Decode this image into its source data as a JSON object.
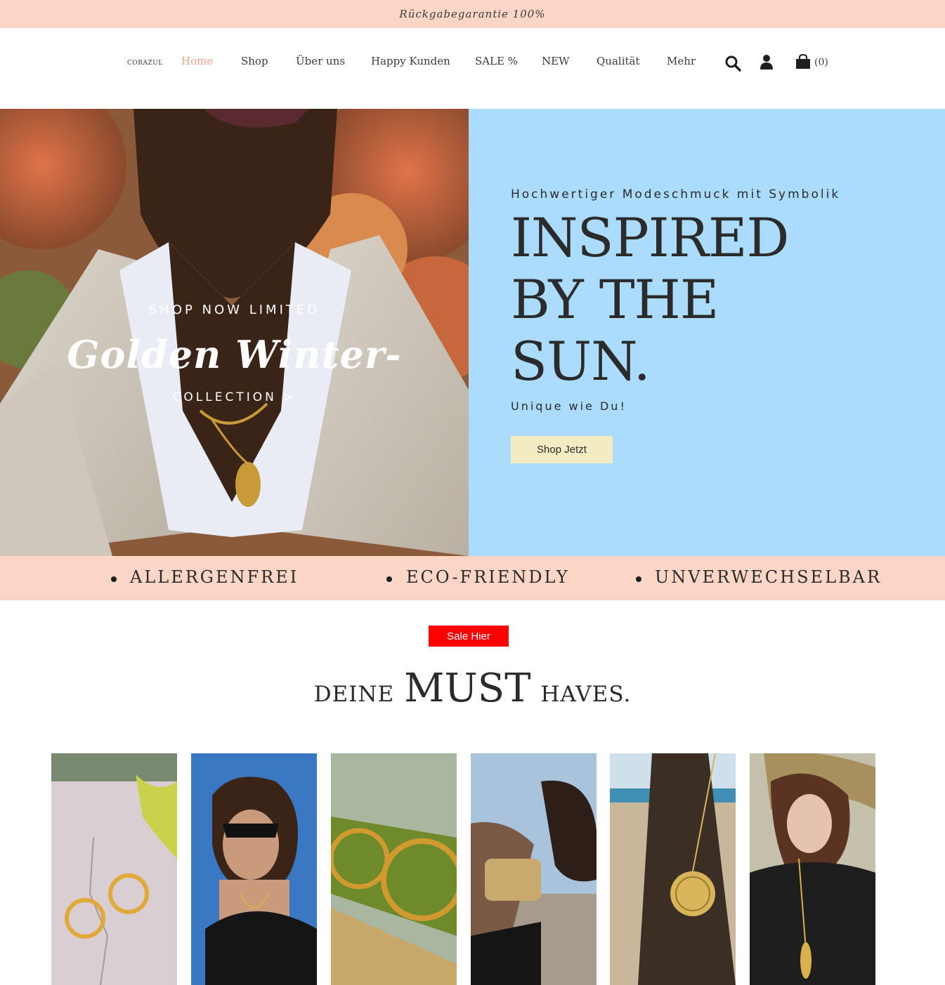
{
  "announcement": "Rückgabegarantie 100%",
  "header": {
    "logo_text": "CORAZUL",
    "nav": [
      {
        "label": "Home",
        "active": true
      },
      {
        "label": "Shop"
      },
      {
        "label": "Über uns"
      },
      {
        "label": "Happy Kunden"
      },
      {
        "label": "SALE %"
      },
      {
        "label": "NEW"
      },
      {
        "label": "Qualität"
      },
      {
        "label": "Mehr"
      }
    ],
    "icons": [
      "search-icon",
      "user-icon",
      "cart-icon"
    ],
    "cart_count": "(0)"
  },
  "hero": {
    "image_overlay": {
      "kicker": "SHOP NOW LIMITED",
      "script_title": "Golden Winter-",
      "link": "COLLECTION  >"
    },
    "kicker": "Hochwertiger Modeschmuck mit Symbolik",
    "title_lines": [
      "INSPIRED",
      "BY THE",
      "SUN."
    ],
    "subtitle": "Unique wie Du!",
    "button": "Shop Jetzt",
    "colors": {
      "panel": "#abdcfd",
      "button": "#f3ecc2"
    }
  },
  "usp": [
    "ALLERGENFREI",
    "ECO-FRIENDLY",
    "UNVERWECHSELBAR"
  ],
  "sale_button": "Sale Hier",
  "section_heading": {
    "part1": "DEINE",
    "part2": "MUST",
    "part3": "HAVES."
  },
  "products": [
    {
      "alt": "Goldene Creolen mit Knoten auf Stein"
    },
    {
      "alt": "Frau mit Sonnenbrille und goldener Kette"
    },
    {
      "alt": "Gedrehte goldene Creolen auf Agave"
    },
    {
      "alt": "Goldenes Armband am Handgelenk"
    },
    {
      "alt": "Medaillon-Anhänger an Holzpfahl"
    },
    {
      "alt": "Frau mit langer Blattkette"
    }
  ],
  "colors": {
    "accent_peach": "#fbd6c6",
    "nav_active": "#f0a58a",
    "sale_red": "#ff0000"
  }
}
